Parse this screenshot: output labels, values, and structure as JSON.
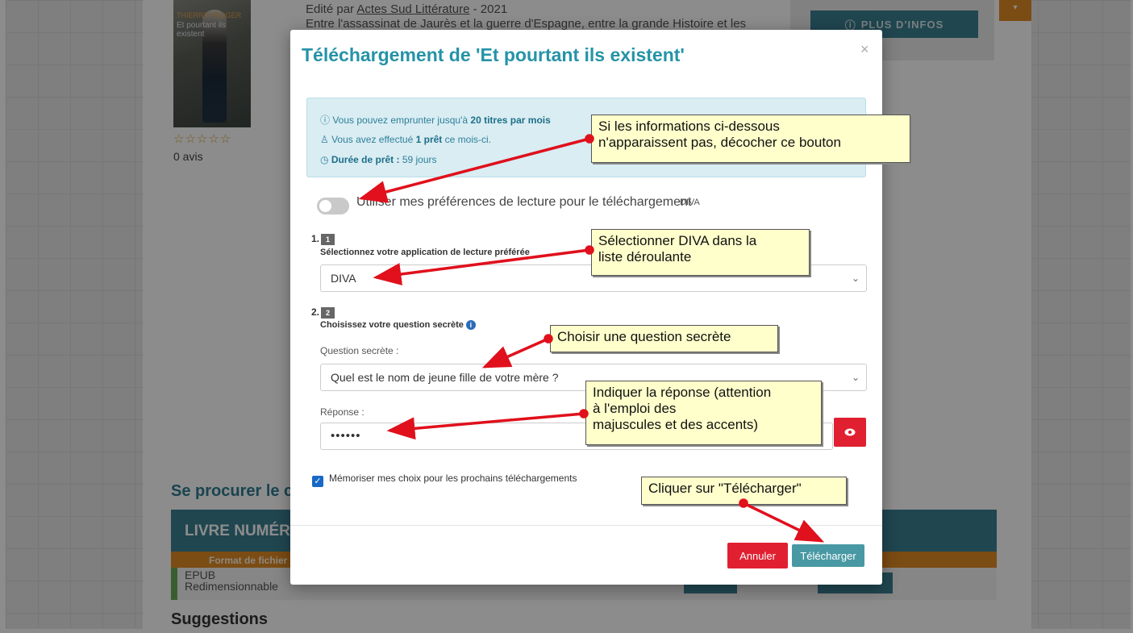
{
  "page": {
    "cover": {
      "author": "THIERRY FROGER",
      "title": "Et pourtant ils existent"
    },
    "stars": "☆☆☆☆☆",
    "avis": "0 avis",
    "edited_prefix": "Edité par ",
    "publisher": "Actes Sud Littérature",
    "edited_suffix": " - 2021",
    "summary": "Entre l'assassinat de Jaurès et la guerre d'Espagne, entre la grande Histoire et les",
    "plus_infos": "PLUS D'INFOS",
    "orange_tab_icon": "▾",
    "section_title": "Se procurer le contenu",
    "livre_title": "LIVRE NUMÉRIQUE",
    "format_label": "Format de fichier",
    "epub_line1": "EPUB",
    "epub_line2": "Redimensionnable",
    "bottom_title": "Suggestions"
  },
  "modal": {
    "title": "Téléchargement de 'Et pourtant ils existent'",
    "close": "×",
    "alert": {
      "line1_pre": "ⓘ Vous pouvez emprunter jusqu'à ",
      "line1_bold": "20 titres par mois",
      "line2_pre": "♙ Vous avez effectué ",
      "line2_bold": "1 prêt",
      "line2_post": " ce mois-ci.",
      "line3_icon": "◷ ",
      "line3_bold": "Durée de prêt :",
      "line3_post": " 59 jours"
    },
    "pref_label": "Utiliser mes préférences de lecture pour le téléchargement",
    "pref_app": "DIVA",
    "step1": {
      "num": "1.",
      "badge": "1",
      "label": "Sélectionnez votre application de lecture préférée",
      "selected": "DIVA"
    },
    "step2": {
      "num": "2.",
      "badge": "2",
      "label": "Choisissez votre question secrète",
      "question_label": "Question secrète :",
      "question_selected": "Quel est le nom de jeune fille de votre mère ?",
      "answer_label": "Réponse :",
      "answer_value": "••••••"
    },
    "remember_label": "Mémoriser mes choix pour les prochains téléchargements",
    "cancel": "Annuler",
    "download": "Télécharger"
  },
  "callouts": {
    "c1": "Si les informations ci-dessous\n n'apparaissent pas, décocher ce bouton",
    "c2": "Sélectionner DIVA dans la\nliste déroulante",
    "c3": "Choisir une question secrète",
    "c4": "Indiquer la réponse (attention\n à l'emploi des\nmajuscules et des accents)",
    "c5": "Cliquer sur \"Télécharger\""
  },
  "colors": {
    "accent": "#2593a7",
    "danger": "#e02030",
    "primary": "#4899a4",
    "orange": "#e08a24",
    "callout_bg": "#ffffcc",
    "arrow": "#e0101c"
  }
}
